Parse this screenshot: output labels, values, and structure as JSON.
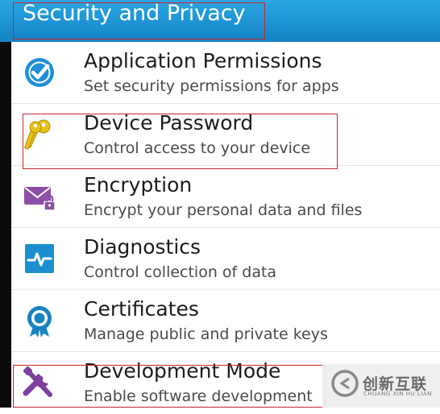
{
  "header": {
    "title": "Security and Privacy"
  },
  "items": [
    {
      "title": "Application Permissions",
      "subtitle": "Set security permissions for apps",
      "icon": "shield-check-icon"
    },
    {
      "title": "Device Password",
      "subtitle": "Control access to your device",
      "icon": "keys-icon"
    },
    {
      "title": "Encryption",
      "subtitle": "Encrypt your personal data and files",
      "icon": "envelope-lock-icon"
    },
    {
      "title": "Diagnostics",
      "subtitle": "Control collection of data",
      "icon": "pulse-icon"
    },
    {
      "title": "Certificates",
      "subtitle": "Manage public and private keys",
      "icon": "certificate-badge-icon"
    },
    {
      "title": "Development Mode",
      "subtitle": "Enable software development",
      "icon": "tools-icon"
    }
  ],
  "watermark": {
    "text_cn": "创新互联",
    "text_en": "CHUANG XIN HU LIAN"
  },
  "colors": {
    "header": "#1e93d6",
    "highlight_border": "#c8242c",
    "app_permissions_icon": "#1e8fd8",
    "device_password_icon": "#e8c21a",
    "encryption_icon": "#8e4fa6",
    "diagnostics_icon": "#1b8fd0",
    "certificates_icon": "#1883c0",
    "development_icon": "#7e3f9e"
  }
}
